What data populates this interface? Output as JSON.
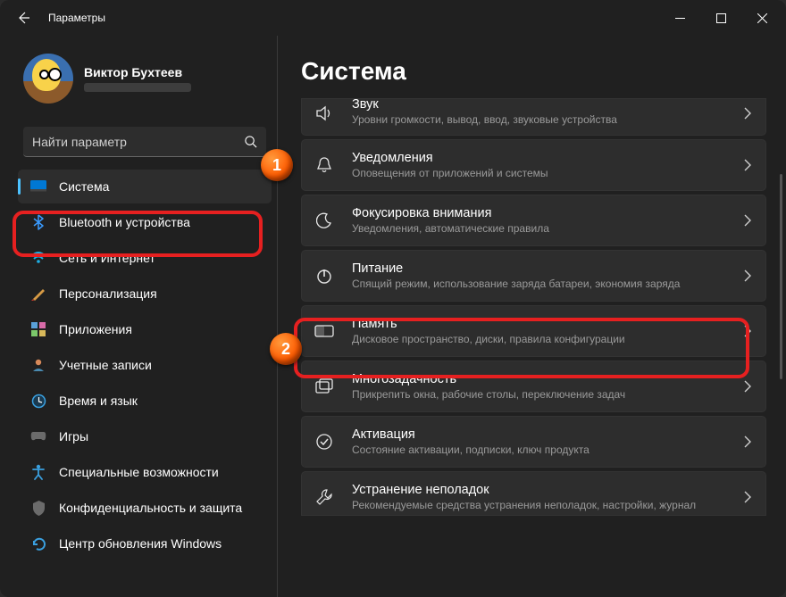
{
  "window": {
    "title": "Параметры"
  },
  "profile": {
    "name": "Виктор Бухтеев"
  },
  "search": {
    "placeholder": "Найти параметр"
  },
  "sidebar": {
    "items": [
      {
        "label": "Система"
      },
      {
        "label": "Bluetooth и устройства"
      },
      {
        "label": "Сеть и Интернет"
      },
      {
        "label": "Персонализация"
      },
      {
        "label": "Приложения"
      },
      {
        "label": "Учетные записи"
      },
      {
        "label": "Время и язык"
      },
      {
        "label": "Игры"
      },
      {
        "label": "Специальные возможности"
      },
      {
        "label": "Конфиденциальность и защита"
      },
      {
        "label": "Центр обновления Windows"
      }
    ]
  },
  "page": {
    "title": "Система"
  },
  "markers": {
    "one": "1",
    "two": "2"
  },
  "tiles": [
    {
      "head": "Звук",
      "sub": "Уровни громкости, вывод, ввод, звуковые устройства"
    },
    {
      "head": "Уведомления",
      "sub": "Оповещения от приложений и системы"
    },
    {
      "head": "Фокусировка внимания",
      "sub": "Уведомления, автоматические правила"
    },
    {
      "head": "Питание",
      "sub": "Спящий режим, использование заряда батареи, экономия заряда"
    },
    {
      "head": "Память",
      "sub": "Дисковое пространство, диски, правила конфигурации"
    },
    {
      "head": "Многозадачность",
      "sub": "Прикрепить окна, рабочие столы, переключение задач"
    },
    {
      "head": "Активация",
      "sub": "Состояние активации, подписки, ключ продукта"
    },
    {
      "head": "Устранение неполадок",
      "sub": "Рекомендуемые средства устранения неполадок, настройки, журнал"
    }
  ]
}
